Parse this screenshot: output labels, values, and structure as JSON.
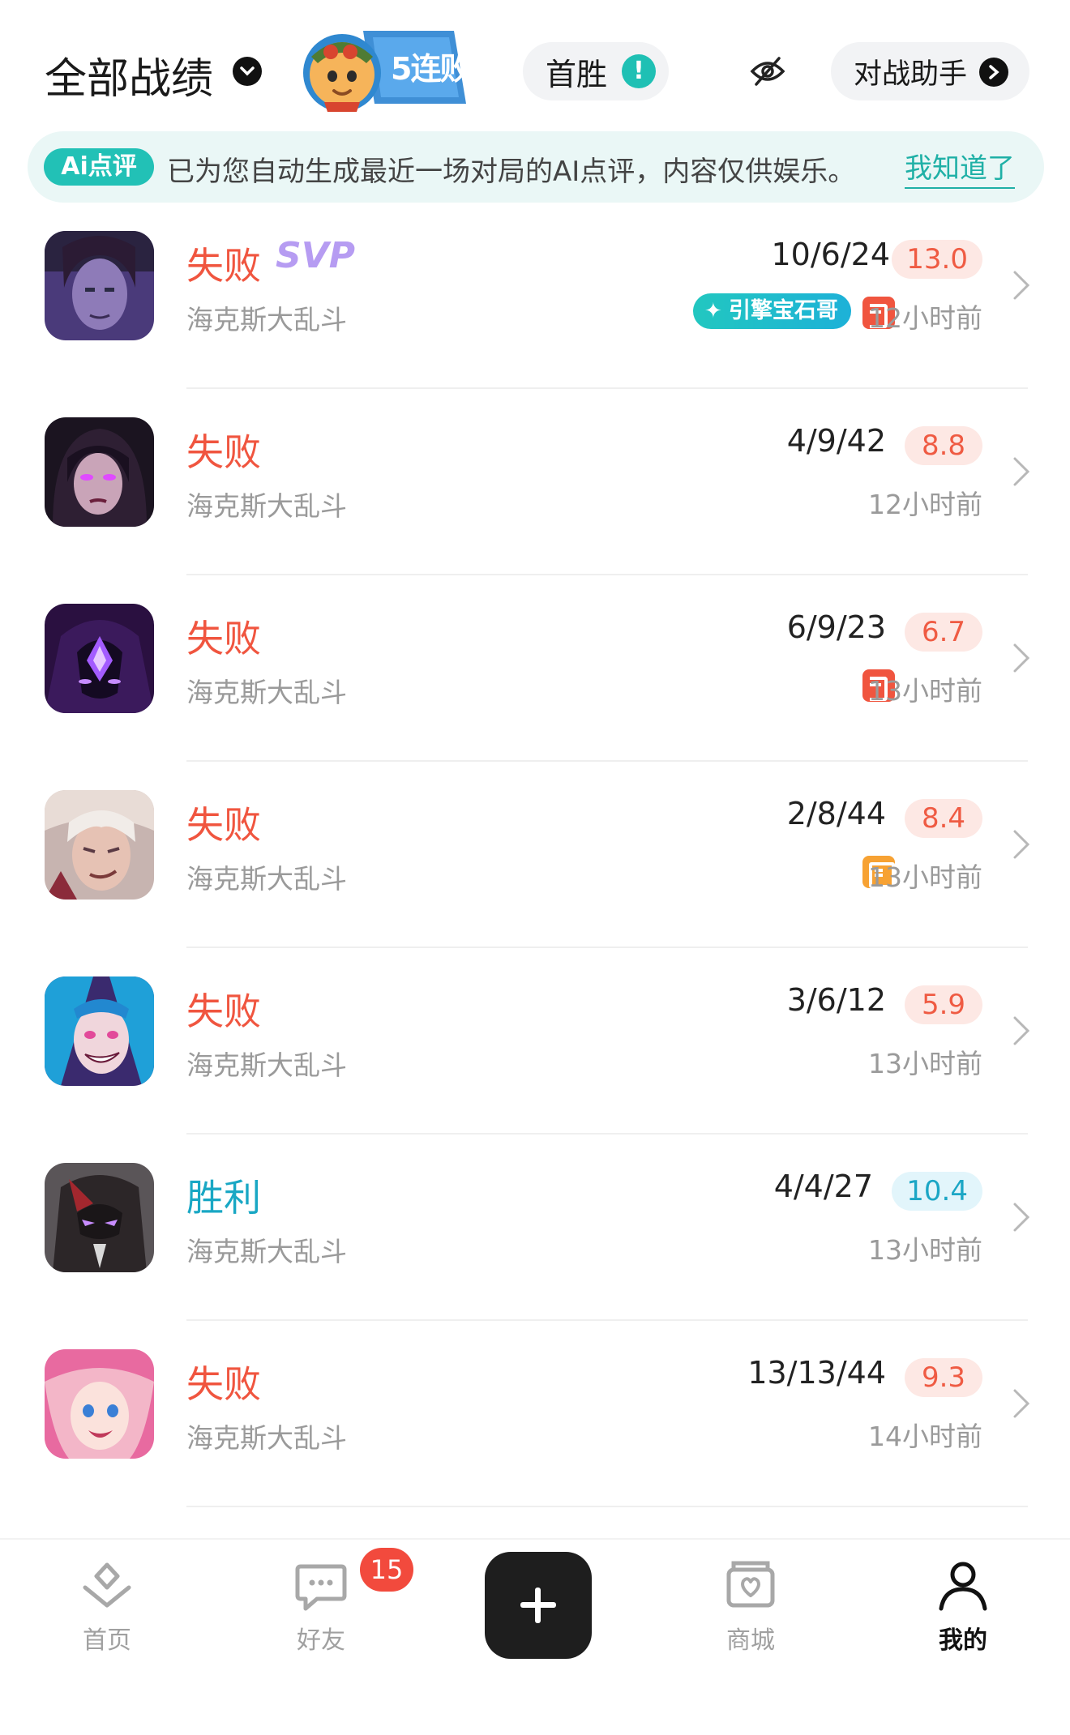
{
  "header": {
    "title": "全部战绩",
    "streak_badge": "5连败",
    "first_win_label": "首胜",
    "first_win_alert": "!",
    "assistant_label": "对战助手"
  },
  "ai_banner": {
    "badge": "Ai点评",
    "text": "已为您自动生成最近一场对局的AI点评，内容仅供娱乐。",
    "dismiss": "我知道了"
  },
  "matches": [
    {
      "result": "失败",
      "outcome": "lose",
      "svp": "SVP",
      "mode": "海克斯大乱斗",
      "kda": "10/6/24",
      "score": "13.0",
      "time": "12小时前",
      "tags": [
        "gem",
        "red"
      ],
      "gem_label": "引擎宝石哥"
    },
    {
      "result": "失败",
      "outcome": "lose",
      "mode": "海克斯大乱斗",
      "kda": "4/9/42",
      "score": "8.8",
      "time": "12小时前",
      "tags": []
    },
    {
      "result": "失败",
      "outcome": "lose",
      "mode": "海克斯大乱斗",
      "kda": "6/9/23",
      "score": "6.7",
      "time": "13小时前",
      "tags": [
        "red"
      ]
    },
    {
      "result": "失败",
      "outcome": "lose",
      "mode": "海克斯大乱斗",
      "kda": "2/8/44",
      "score": "8.4",
      "time": "13小时前",
      "tags": [
        "orange"
      ]
    },
    {
      "result": "失败",
      "outcome": "lose",
      "mode": "海克斯大乱斗",
      "kda": "3/6/12",
      "score": "5.9",
      "time": "13小时前",
      "tags": []
    },
    {
      "result": "胜利",
      "outcome": "win",
      "mode": "海克斯大乱斗",
      "kda": "4/4/27",
      "score": "10.4",
      "time": "13小时前",
      "tags": []
    },
    {
      "result": "失败",
      "outcome": "lose",
      "mode": "海克斯大乱斗",
      "kda": "13/13/44",
      "score": "9.3",
      "time": "14小时前",
      "tags": []
    }
  ],
  "bottom_nav": {
    "home": "首页",
    "friends": "好友",
    "friends_badge": "15",
    "shop": "商城",
    "me": "我的"
  },
  "colors": {
    "lose": "#f0553f",
    "win": "#19a7c4",
    "accent": "#22c1b6"
  }
}
